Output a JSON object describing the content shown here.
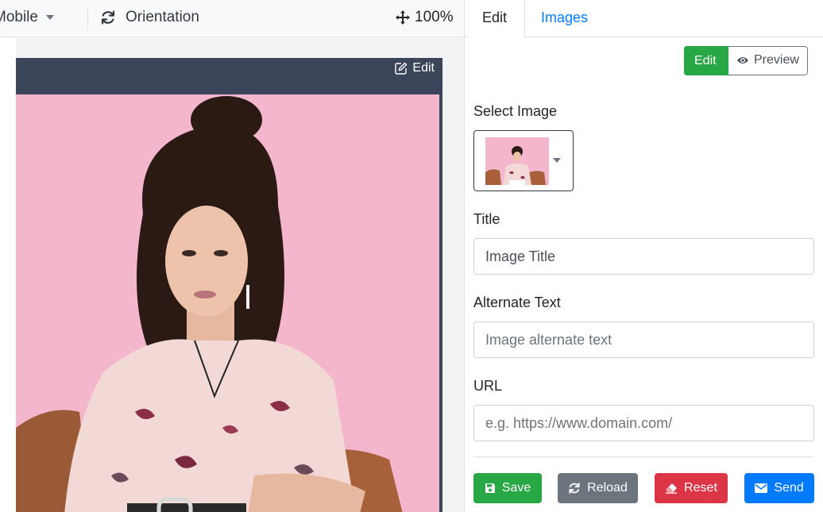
{
  "toolbar": {
    "device_label": "Mobile",
    "orientation_label": "Orientation",
    "zoom_label": "100%"
  },
  "preview": {
    "edit_label": "Edit"
  },
  "panel": {
    "tabs": [
      {
        "label": "Edit",
        "active": true
      },
      {
        "label": "Images",
        "active": false
      }
    ],
    "mode": {
      "edit_label": "Edit",
      "preview_label": "Preview"
    },
    "select_image_label": "Select Image",
    "title": {
      "label": "Title",
      "value": "Image Title"
    },
    "alt_text": {
      "label": "Alternate Text",
      "placeholder": "Image alternate text"
    },
    "url": {
      "label": "URL",
      "placeholder": "e.g. https://www.domain.com/"
    },
    "buttons": {
      "save": "Save",
      "reload": "Reload",
      "reset": "Reset",
      "send": "Send"
    }
  },
  "colors": {
    "success": "#28a745",
    "secondary": "#6c757d",
    "danger": "#dc3545",
    "primary": "#007bff",
    "frame": "#3b4559",
    "photo_background": "#f4b6cc"
  },
  "icons": {
    "orientation": "sync-icon",
    "zoom": "arrows-move-icon",
    "frame_edit": "pencil-square-icon",
    "preview": "eye-icon",
    "save": "floppy-disk-icon",
    "reload": "sync-icon",
    "reset": "eraser-icon",
    "send": "envelope-icon"
  }
}
